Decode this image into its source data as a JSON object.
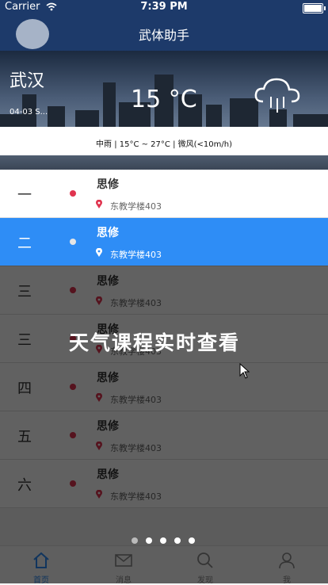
{
  "status_bar": {
    "carrier": "Carrier",
    "time": "7:39 PM"
  },
  "nav": {
    "title": "武体助手"
  },
  "weather": {
    "city": "武汉",
    "date": "04-03 S...",
    "temperature": "15 °C",
    "description": "中雨 | 15°C ~ 27°C | 微风(<10m/h)",
    "icon": "rain-cloud-icon"
  },
  "schedule": [
    {
      "day": "一",
      "course": "思修",
      "room": "东教学楼403",
      "active": false
    },
    {
      "day": "二",
      "course": "思修",
      "room": "东教学楼403",
      "active": true
    },
    {
      "day": "三",
      "course": "思修",
      "room": "东教学楼403",
      "active": false
    },
    {
      "day": "三",
      "course": "思修",
      "room": "东教学楼403",
      "active": false
    },
    {
      "day": "四",
      "course": "思修",
      "room": "东教学楼403",
      "active": false
    },
    {
      "day": "五",
      "course": "思修",
      "room": "东教学楼403",
      "active": false
    },
    {
      "day": "六",
      "course": "思修",
      "room": "东教学楼403",
      "active": false
    }
  ],
  "overlay": {
    "caption": "天气课程实时查看",
    "page_count": 5,
    "current_page": 1
  },
  "tabbar": {
    "items": [
      {
        "label": "首页",
        "icon": "home-icon",
        "active": true
      },
      {
        "label": "消息",
        "icon": "mail-icon",
        "active": false
      },
      {
        "label": "发现",
        "icon": "search-icon",
        "active": false
      },
      {
        "label": "我",
        "icon": "user-icon",
        "active": false
      }
    ]
  },
  "colors": {
    "nav": "#1d3a6a",
    "accent": "#2e8df6",
    "dot": "#e0344f"
  }
}
